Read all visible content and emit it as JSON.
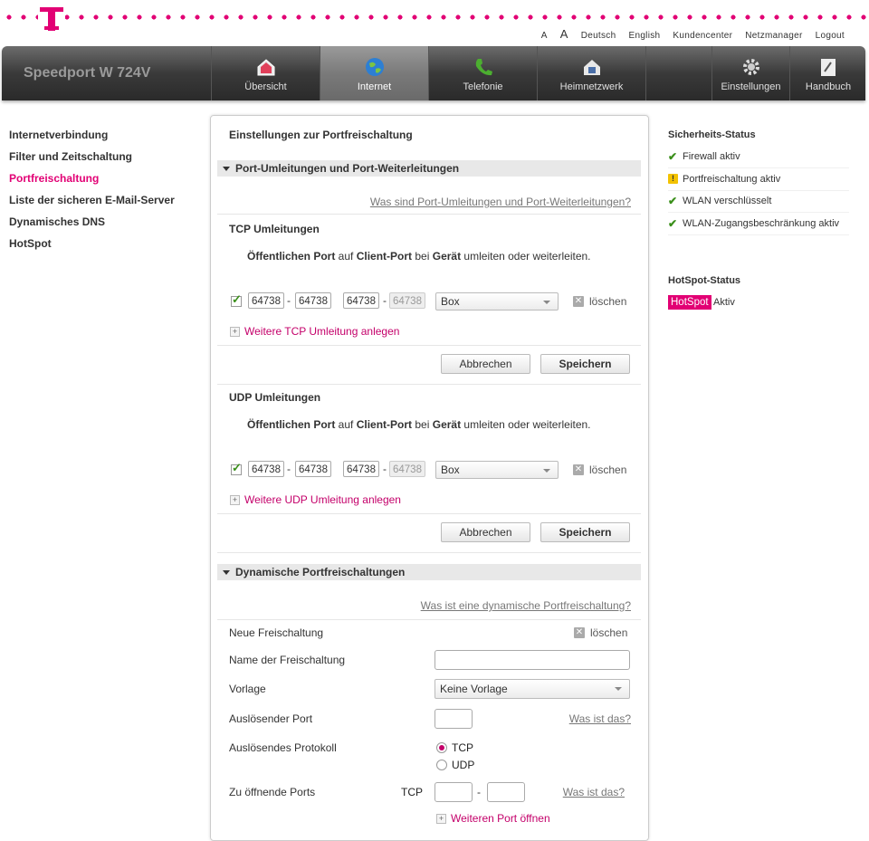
{
  "topbar": {
    "font_small": "A",
    "font_large": "A",
    "links": [
      "Deutsch",
      "English",
      "Kundencenter",
      "Netzmanager",
      "Logout"
    ]
  },
  "header": {
    "device_name": "Speedport W 724V",
    "tabs": [
      {
        "label": "Übersicht",
        "icon": "house-icon"
      },
      {
        "label": "Internet",
        "icon": "globe-icon"
      },
      {
        "label": "Telefonie",
        "icon": "phone-icon"
      },
      {
        "label": "Heimnetzwerk",
        "icon": "home-network-icon"
      },
      {
        "label": "Einstellungen",
        "icon": "gear-icon"
      },
      {
        "label": "Handbuch",
        "icon": "manual-icon"
      }
    ],
    "active_tab": "Internet"
  },
  "sidebar": {
    "items": [
      "Internetverbindung",
      "Filter und Zeitschaltung",
      "Portfreischaltung",
      "Liste der sicheren E-Mail-Server",
      "Dynamisches DNS",
      "HotSpot"
    ],
    "active": "Portfreischaltung"
  },
  "main": {
    "title": "Einstellungen zur Portfreischaltung",
    "section1": {
      "heading": "Port-Umleitungen und Port-Weiterleitungen",
      "help_link": "Was sind Port-Umleitungen und Port-Weiterleitungen?",
      "tcp": {
        "heading": "TCP Umleitungen",
        "desc": [
          "Öffentlichen Port",
          " auf ",
          "Client-Port",
          " bei ",
          "Gerät",
          " umleiten oder weiterleiten."
        ],
        "row": {
          "checked": true,
          "public_from": "64738",
          "public_to": "64738",
          "client_from": "64738",
          "client_to": "64738",
          "device": "Box",
          "delete": "löschen"
        },
        "add_link": "Weitere TCP Umleitung anlegen"
      },
      "udp": {
        "heading": "UDP Umleitungen",
        "desc": [
          "Öffentlichen Port",
          " auf ",
          "Client-Port",
          " bei ",
          "Gerät",
          " umleiten oder weiterleiten."
        ],
        "row": {
          "checked": true,
          "public_from": "64738",
          "public_to": "64738",
          "client_from": "64738",
          "client_to": "64738",
          "device": "Box",
          "delete": "löschen"
        },
        "add_link": "Weitere UDP Umleitung anlegen"
      },
      "cancel": "Abbrechen",
      "save": "Speichern"
    },
    "section2": {
      "heading": "Dynamische Portfreischaltungen",
      "help_link": "Was ist eine dynamische Portfreischaltung?",
      "new_label": "Neue Freischaltung",
      "delete": "löschen",
      "name_label": "Name der Freischaltung",
      "name_value": "",
      "template_label": "Vorlage",
      "template_value": "Keine Vorlage",
      "trigger_port_label": "Auslösender Port",
      "trigger_port_value": "",
      "whats_that": "Was ist das?",
      "protocol_label": "Auslösendes Protokoll",
      "protocol_options": [
        "TCP",
        "UDP"
      ],
      "protocol_selected": "TCP",
      "open_ports_label": "Zu öffnende Ports",
      "open_ports_proto": "TCP",
      "open_from": "",
      "open_to": "",
      "add_port_link": "Weiteren Port öffnen"
    }
  },
  "security_status": {
    "heading": "Sicherheits-Status",
    "items": [
      {
        "text": "Firewall aktiv",
        "state": "ok"
      },
      {
        "text": "Portfreischaltung aktiv",
        "state": "warning"
      },
      {
        "text": "WLAN verschlüsselt",
        "state": "ok"
      },
      {
        "text": "WLAN-Zugangsbeschränkung aktiv",
        "state": "ok"
      }
    ]
  },
  "hotspot_status": {
    "heading": "HotSpot-Status",
    "badge": "HotSpot",
    "value": "Aktiv"
  },
  "colors": {
    "accent": "#e20074",
    "ok": "#3a8f1a",
    "warning": "#f3c200"
  }
}
